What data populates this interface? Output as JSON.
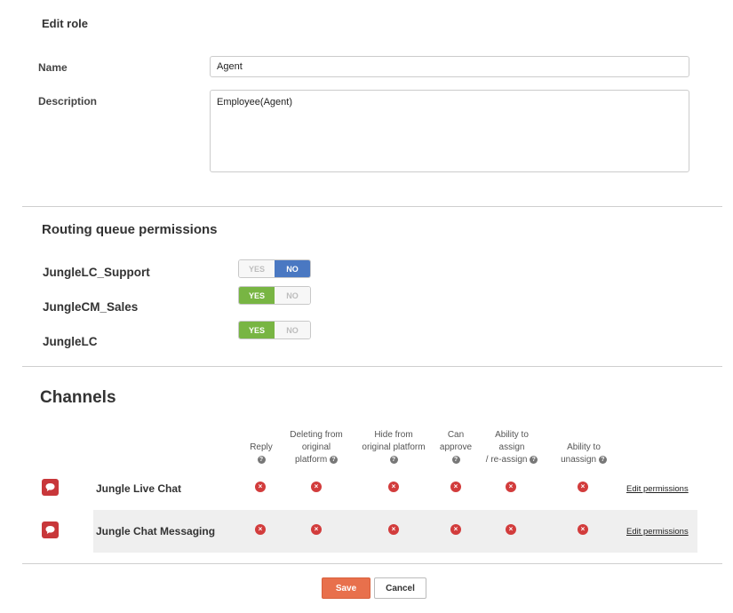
{
  "page": {
    "title": "Edit role"
  },
  "form": {
    "name_label": "Name",
    "name_value": "Agent",
    "description_label": "Description",
    "description_value": "Employee(Agent)"
  },
  "routing": {
    "title": "Routing queue permissions",
    "queues": [
      {
        "name": "JungleLC_Support",
        "yes_label": "YES",
        "no_label": "NO",
        "selected": "NO"
      },
      {
        "name": "JungleCM_Sales",
        "yes_label": "YES",
        "no_label": "NO",
        "selected": "YES"
      },
      {
        "name": "JungleLC",
        "yes_label": "YES",
        "no_label": "NO",
        "selected": "YES"
      }
    ]
  },
  "channels": {
    "title": "Channels",
    "columns": [
      {
        "line1": "Reply",
        "line2": "",
        "line3": ""
      },
      {
        "line1": "Deleting from",
        "line2": "original",
        "line3": "platform"
      },
      {
        "line1": "Hide from",
        "line2": "original platform",
        "line3": ""
      },
      {
        "line1": "Can",
        "line2": "approve",
        "line3": ""
      },
      {
        "line1": "Ability to",
        "line2": "assign",
        "line3": "/ re-assign"
      },
      {
        "line1": "Ability to",
        "line2": "unassign",
        "line3": ""
      }
    ],
    "help_glyph": "?",
    "denied_glyph": "×",
    "rows": [
      {
        "name": "Jungle Live Chat",
        "edit_label": "Edit permissions"
      },
      {
        "name": "Jungle Chat Messaging",
        "edit_label": "Edit permissions"
      }
    ]
  },
  "actions": {
    "save_label": "Save",
    "cancel_label": "Cancel"
  },
  "colors": {
    "accent": "#e8704c",
    "yes": "#78b543",
    "no": "#4a78c2",
    "denied": "#d23c3c",
    "channel_icon": "#c8373a"
  }
}
